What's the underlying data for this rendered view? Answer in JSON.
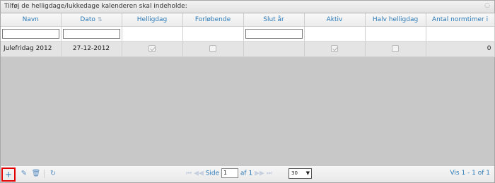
{
  "caption": {
    "title": "Tilføj de helligdage/lukkedage kalenderen skal indeholde:",
    "close_icon": "close-icon"
  },
  "columns": [
    {
      "key": "navn",
      "label": "Navn"
    },
    {
      "key": "dato",
      "label": "Dato",
      "sort_icon": "sort-icon"
    },
    {
      "key": "helligdag",
      "label": "Helligdag"
    },
    {
      "key": "forlobende",
      "label": "Forløbende"
    },
    {
      "key": "slut_ar",
      "label": "Slut år"
    },
    {
      "key": "aktiv",
      "label": "Aktiv"
    },
    {
      "key": "halv_helligdag",
      "label": "Halv helligdag"
    },
    {
      "key": "antal_normtimer",
      "label": "Antal normtimer i"
    }
  ],
  "filters": {
    "navn": "",
    "dato": "",
    "slut_ar": ""
  },
  "rows": [
    {
      "navn": "Julefridag 2012",
      "dato": "27-12-2012",
      "helligdag": true,
      "forlobende": false,
      "slut_ar": "",
      "aktiv": true,
      "halv_helligdag": false,
      "antal_normtimer": "0"
    }
  ],
  "pager": {
    "buttons": [
      "add-icon",
      "edit-icon",
      "delete-icon",
      "refresh-icon"
    ],
    "page_label": "Side",
    "current_page": "1",
    "of_label": "af 1",
    "rows_per_page": "30",
    "view_info": "Vis 1 - 1 of 1"
  }
}
